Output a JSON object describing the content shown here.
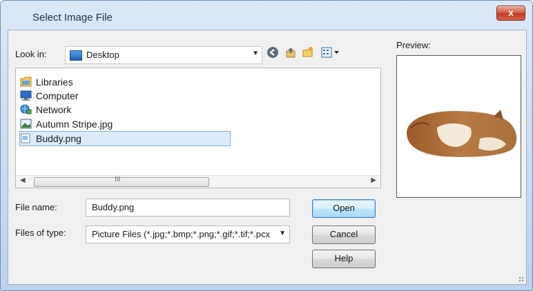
{
  "window": {
    "title": "Select Image File",
    "close_label": "x"
  },
  "look_in": {
    "label": "Look in:",
    "value": "Desktop"
  },
  "toolbar": {
    "back_icon": "back-arrow-icon",
    "up_icon": "up-folder-icon",
    "new_folder_icon": "new-folder-icon",
    "view_menu_icon": "view-menu-icon"
  },
  "files": [
    {
      "name": "Libraries",
      "icon": "libraries-icon"
    },
    {
      "name": "Computer",
      "icon": "computer-icon"
    },
    {
      "name": "Network",
      "icon": "network-icon"
    },
    {
      "name": "Autumn Stripe.jpg",
      "icon": "image-file-icon"
    },
    {
      "name": "Buddy.png",
      "icon": "image-file-icon",
      "selected": true
    }
  ],
  "scrollbar": {
    "grip": "III"
  },
  "file_name": {
    "label": "File name:",
    "value": "Buddy.png"
  },
  "file_type": {
    "label": "Files of type:",
    "value": "Picture Files (*.jpg;*.bmp;*.png;*.gif;*.tif;*.pcx"
  },
  "buttons": {
    "open": "Open",
    "cancel": "Cancel",
    "help": "Help"
  },
  "preview": {
    "label": "Preview:",
    "image": "sleeping-cat-photo"
  }
}
